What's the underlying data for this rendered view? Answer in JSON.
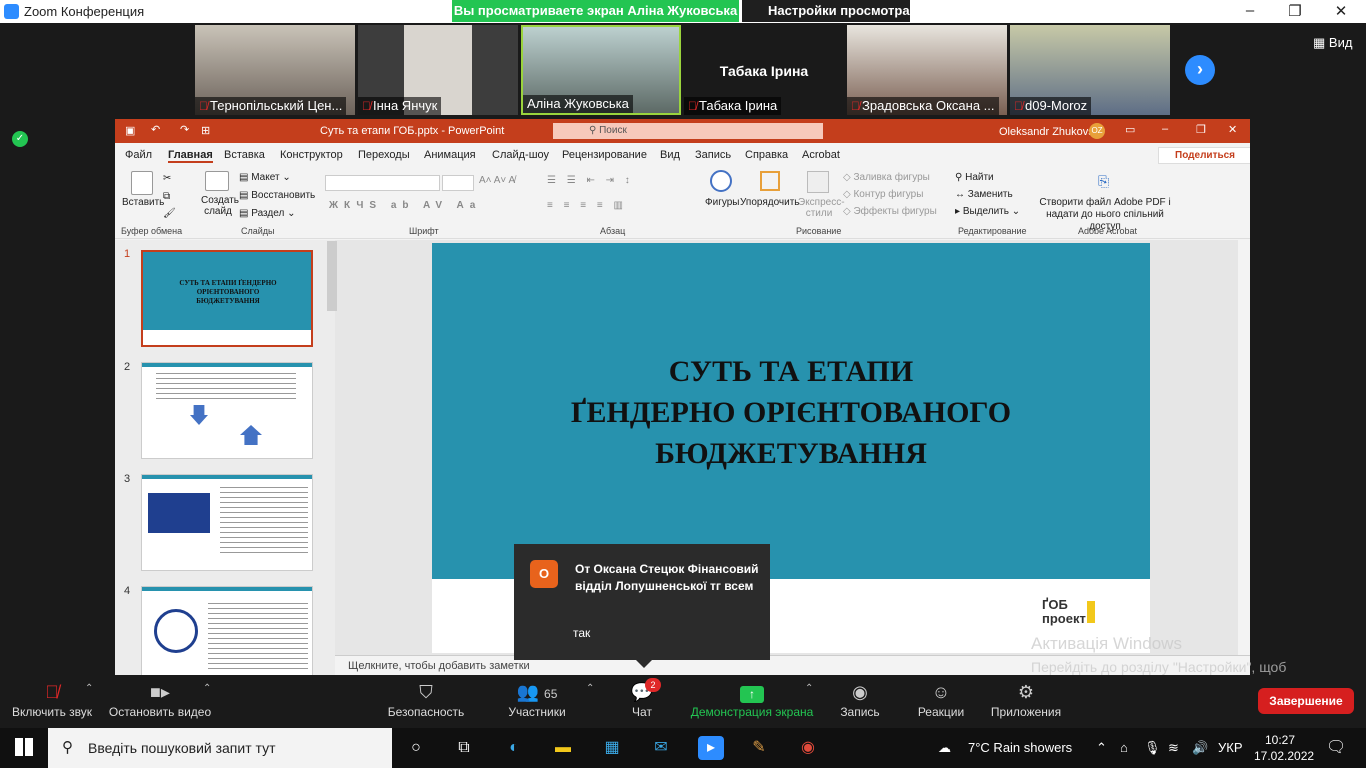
{
  "zoom": {
    "window_title": "Zoom Конференция",
    "viewing_banner": "Вы просматриваете экран Аліна Жуковська",
    "view_options": "Настройки просмотра",
    "view_button": "Вид",
    "participants_strip": [
      {
        "name": "Тернопільський Цен...",
        "muted": true
      },
      {
        "name": "Інна Янчук",
        "muted": true
      },
      {
        "name": "Аліна Жуковська",
        "muted": false,
        "active_speaker": true
      },
      {
        "name": "Табака Ірина",
        "muted": true,
        "no_video_label": "Табака Ірина"
      },
      {
        "name": "Зрадовська Оксана ...",
        "muted": true
      },
      {
        "name": "d09-Moroz",
        "muted": true
      }
    ]
  },
  "powerpoint": {
    "file_title": "Суть та етапи ГОБ.pptx  -  PowerPoint",
    "search_placeholder": "Поиск",
    "user_name": "Oleksandr Zhukovsky",
    "user_initials": "OZ",
    "menu": [
      "Файл",
      "Главная",
      "Вставка",
      "Конструктор",
      "Переходы",
      "Анимация",
      "Слайд-шоу",
      "Рецензирование",
      "Вид",
      "Запись",
      "Справка",
      "Acrobat"
    ],
    "active_menu": "Главная",
    "share_label": "Поделиться",
    "ribbon": {
      "paste": "Вставить",
      "new_slide": "Создать слайд",
      "layout": "Макет",
      "reset": "Восстановить",
      "section": "Раздел",
      "shapes": "Фигуры",
      "arrange": "Упорядочить",
      "quick_styles": "Экспресс-стили",
      "shape_fill": "Заливка фигуры",
      "shape_outline": "Контур фигуры",
      "shape_effects": "Эффекты фигуры",
      "find": "Найти",
      "replace": "Заменить",
      "select": "Выделить",
      "adobe": "Створити файл Adobe PDF і надати до нього спільний доступ",
      "groups": [
        "Буфер обмена",
        "Слайды",
        "Шрифт",
        "Абзац",
        "Рисование",
        "Редактирование",
        "Adobe Acrobat"
      ]
    },
    "thumbnails": [
      "1",
      "2",
      "3",
      "4"
    ],
    "thumb1_text": "СУТЬ ТА ЕТАПИ ҐЕНДЕРНО ОРІЄНТОВАНОГО БЮДЖЕТУВАННЯ",
    "slide_title_lines": [
      "СУТЬ ТА ЕТАПИ",
      "ҐЕНДЕРНО ОРІЄНТОВАНОГО",
      "БЮДЖЕТУВАННЯ"
    ],
    "slide_logo": "ҐОБ проект",
    "notes_placeholder": "Щелкните, чтобы добавить заметки"
  },
  "chat_toast": {
    "avatar_letter": "О",
    "from": "От Оксана Стецюк Фінансовий відділ Лопушненської тг всем",
    "message": "так"
  },
  "watermark": {
    "line1": "Активація Windows",
    "line2": "Перейдіть до розділу \"Настройки\", щоб активувати Windows."
  },
  "controls": {
    "mic": "Включить звук",
    "video": "Остановить видео",
    "security": "Безопасность",
    "participants": "Участники",
    "participants_count": "65",
    "chat": "Чат",
    "chat_badge": "2",
    "share": "Демонстрация экрана",
    "record": "Запись",
    "reactions": "Реакции",
    "apps": "Приложения",
    "end": "Завершение"
  },
  "taskbar": {
    "search_placeholder": "Введіть пошуковий запит тут",
    "weather": "7°C  Rain showers",
    "lang": "УКР",
    "time": "10:27",
    "date": "17.02.2022"
  },
  "colors": {
    "zoom_green": "#23c552",
    "ppt_red": "#c43e1c",
    "slide_teal": "#2792ae",
    "end_red": "#d61f1f"
  }
}
